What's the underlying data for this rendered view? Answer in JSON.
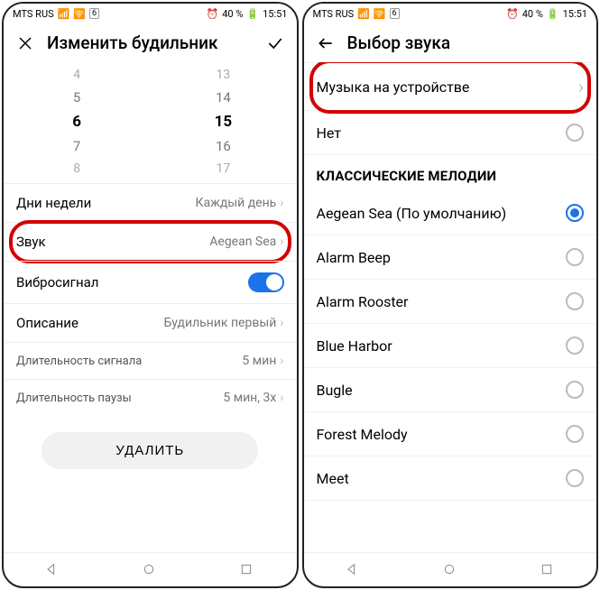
{
  "status": {
    "carrier": "MTS RUS",
    "sig": "6",
    "batt": "40 %",
    "time": "15:51"
  },
  "screen1": {
    "title": "Изменить будильник",
    "picker": {
      "hours": [
        "4",
        "5",
        "6",
        "7",
        "8"
      ],
      "mins": [
        "13",
        "14",
        "15",
        "16",
        "17"
      ],
      "sel_index": 2
    },
    "rows": {
      "days": {
        "label": "Дни недели",
        "value": "Каждый день"
      },
      "sound": {
        "label": "Звук",
        "value": "Aegean Sea"
      },
      "vibrate": {
        "label": "Вибросигнал"
      },
      "desc": {
        "label": "Описание",
        "value": "Будильник первый"
      },
      "dur": {
        "label": "Длительность сигнала",
        "value": "5 мин"
      },
      "pause": {
        "label": "Длительность паузы",
        "value": "5 мин, 3x"
      }
    },
    "delete": "УДАЛИТЬ"
  },
  "screen2": {
    "title": "Выбор звука",
    "device_music": "Музыка на устройстве",
    "none": "Нет",
    "section": "КЛАССИЧЕСКИЕ МЕЛОДИИ",
    "items": [
      {
        "label": "Aegean Sea (По умолчанию)",
        "checked": true
      },
      {
        "label": "Alarm Beep",
        "checked": false
      },
      {
        "label": "Alarm Rooster",
        "checked": false
      },
      {
        "label": "Blue Harbor",
        "checked": false
      },
      {
        "label": "Bugle",
        "checked": false
      },
      {
        "label": "Forest Melody",
        "checked": false
      },
      {
        "label": "Meet",
        "checked": false
      }
    ]
  }
}
